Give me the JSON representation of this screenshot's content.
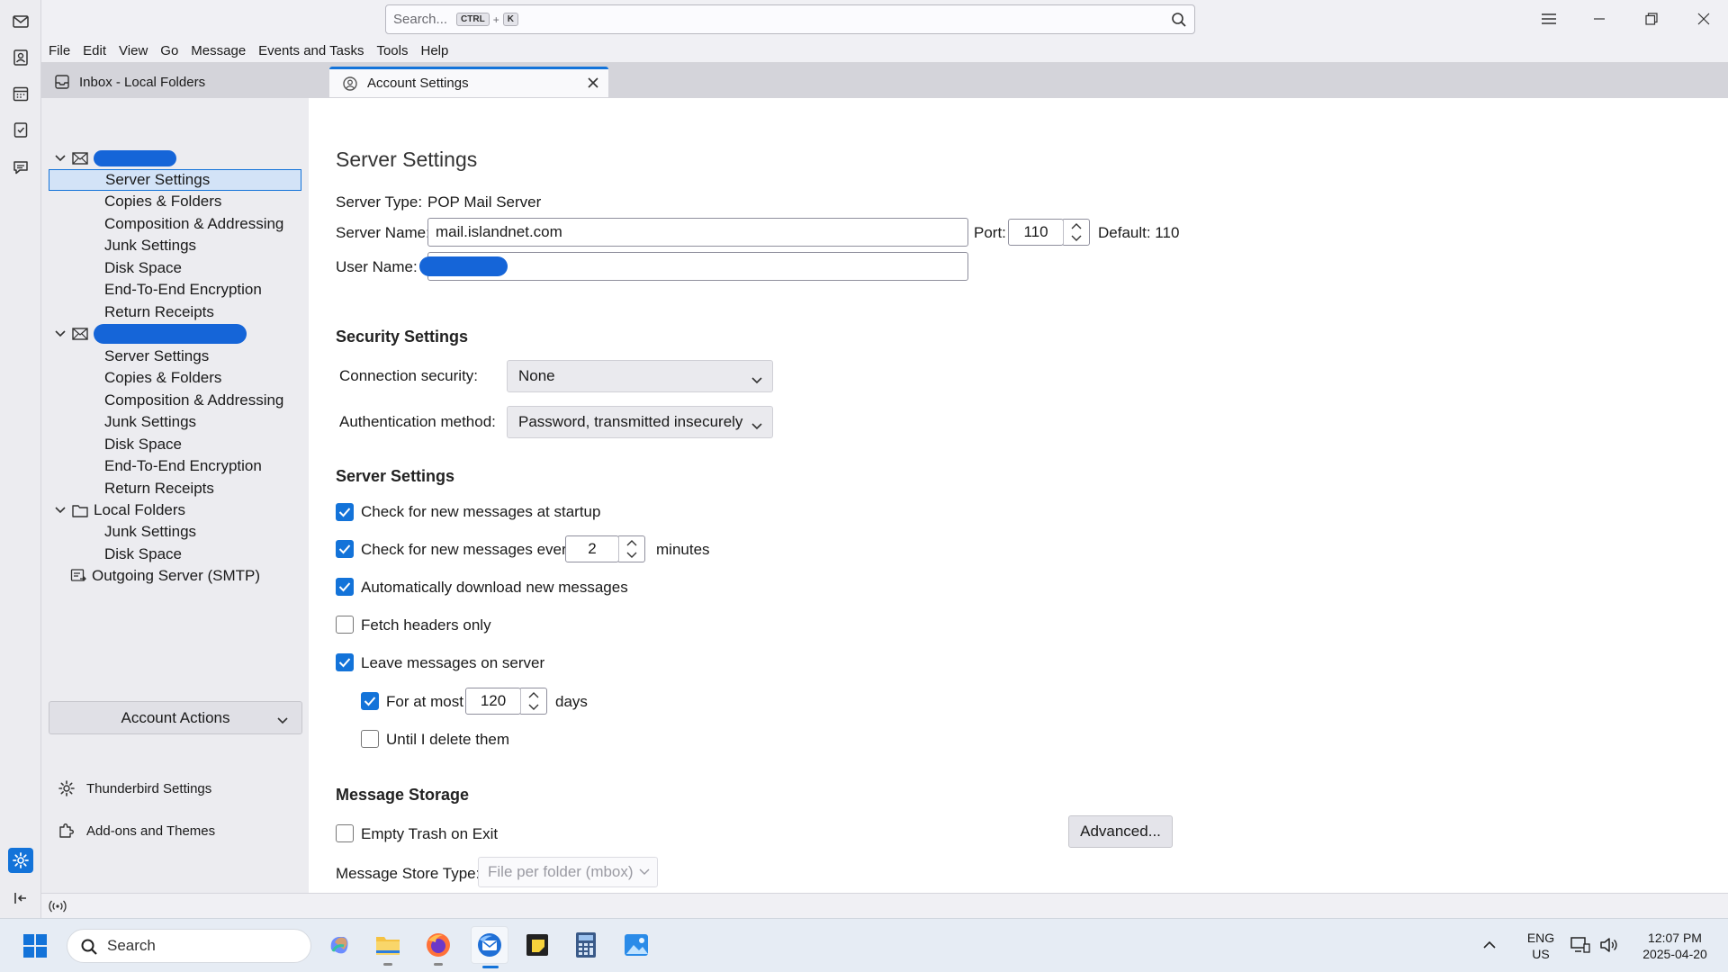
{
  "titlebar": {
    "search_placeholder": "Search...",
    "shortcut_key1": "CTRL",
    "shortcut_plus": "+",
    "shortcut_key2": "K"
  },
  "menu": [
    "File",
    "Edit",
    "View",
    "Go",
    "Message",
    "Events and Tasks",
    "Tools",
    "Help"
  ],
  "tabs": [
    {
      "label": "Inbox - Local Folders"
    },
    {
      "label": "Account Settings"
    }
  ],
  "sidebar": {
    "account1_items": [
      "Server Settings",
      "Copies & Folders",
      "Composition & Addressing",
      "Junk Settings",
      "Disk Space",
      "End-To-End Encryption",
      "Return Receipts"
    ],
    "account2_items": [
      "Server Settings",
      "Copies & Folders",
      "Composition & Addressing",
      "Junk Settings",
      "Disk Space",
      "End-To-End Encryption",
      "Return Receipts"
    ],
    "local_folders": "Local Folders",
    "local_items": [
      "Junk Settings",
      "Disk Space"
    ],
    "outgoing": "Outgoing Server (SMTP)",
    "account_actions": "Account Actions",
    "thunderbird_settings": "Thunderbird Settings",
    "addons": "Add-ons and Themes"
  },
  "main": {
    "title": "Server Settings",
    "server_type_label": "Server Type:",
    "server_type_value": "POP Mail Server",
    "server_name_label": "Server Name:",
    "server_name_value": "mail.islandnet.com",
    "port_label": "Port:",
    "port_value": "110",
    "default_label": "Default: 110",
    "user_name_label": "User Name:",
    "security_heading": "Security Settings",
    "conn_security_label": "Connection security:",
    "conn_security_value": "None",
    "auth_method_label": "Authentication method:",
    "auth_method_value": "Password, transmitted insecurely",
    "server_settings_heading": "Server Settings",
    "check_startup": "Check for new messages at startup",
    "check_every": "Check for new messages every",
    "check_every_value": "2",
    "minutes": "minutes",
    "auto_download": "Automatically download new messages",
    "fetch_headers": "Fetch headers only",
    "leave_on_server": "Leave messages on server",
    "for_at_most": "For at most",
    "for_at_most_value": "120",
    "days": "days",
    "until_delete": "Until I delete them",
    "storage_heading": "Message Storage",
    "empty_trash": "Empty Trash on Exit",
    "advanced_button": "Advanced...",
    "store_type_label": "Message Store Type:",
    "store_type_value": "File per folder (mbox)"
  },
  "checkboxes": {
    "check_startup": true,
    "check_every": true,
    "auto_download": true,
    "fetch_headers": false,
    "leave_on_server": true,
    "for_at_most": true,
    "until_delete": false,
    "empty_trash": false
  },
  "taskbar": {
    "search": "Search",
    "lang1": "ENG",
    "lang2": "US",
    "time": "12:07 PM",
    "date": "2025-04-20"
  },
  "colors": {
    "accent": "#1373d9",
    "redaction": "#1565d8"
  }
}
